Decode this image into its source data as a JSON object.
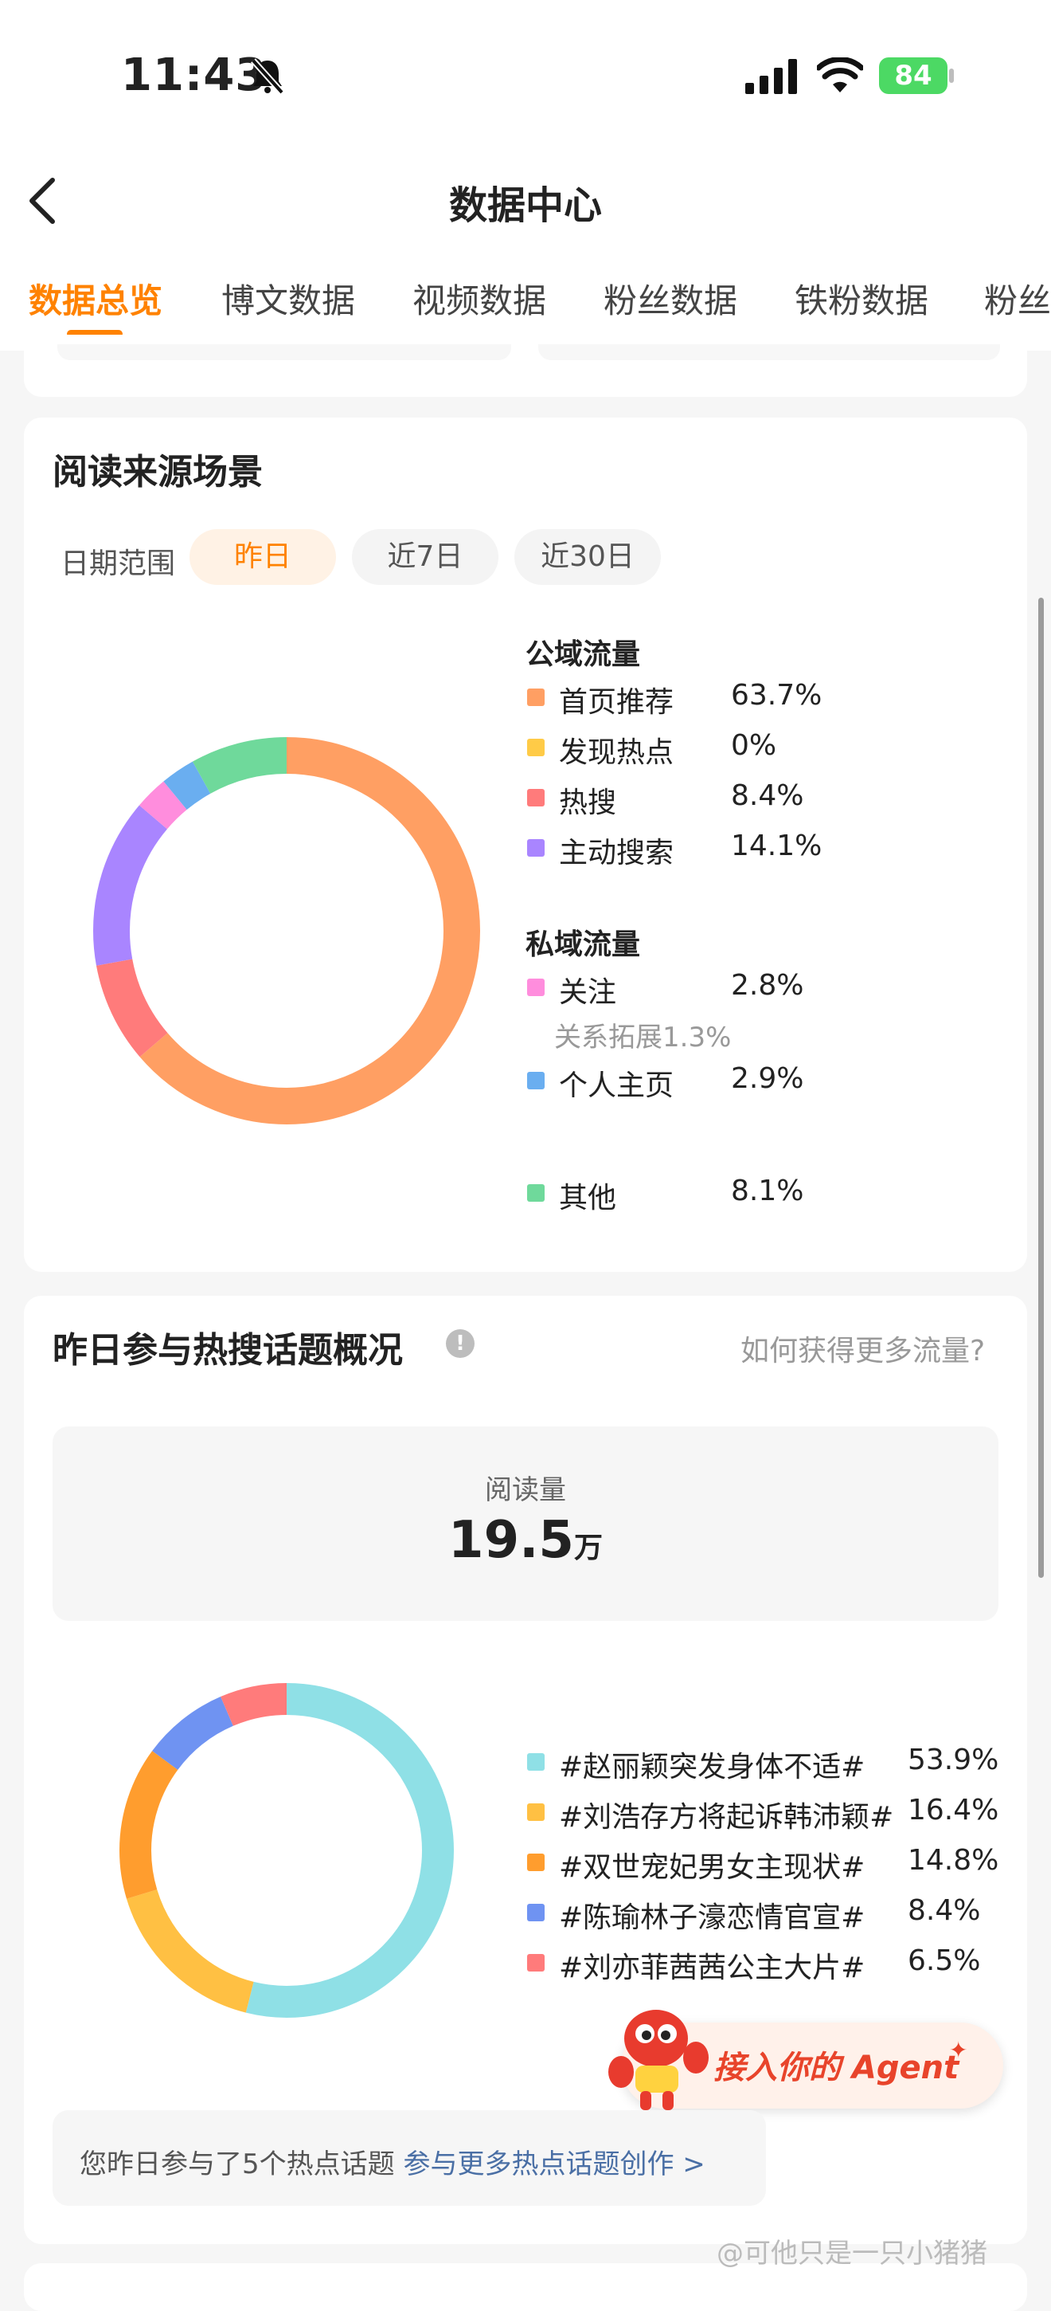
{
  "status": {
    "time": "11:43",
    "battery": "84"
  },
  "header": {
    "title": "数据中心"
  },
  "tabs": [
    {
      "label": "数据总览",
      "active": true
    },
    {
      "label": "博文数据"
    },
    {
      "label": "视频数据"
    },
    {
      "label": "粉丝数据"
    },
    {
      "label": "铁粉数据"
    },
    {
      "label": "粉丝"
    }
  ],
  "read_source": {
    "title": "阅读来源场景",
    "date_label": "日期范围",
    "ranges": [
      "昨日",
      "近7日",
      "近30日"
    ],
    "public_header": "公域流量",
    "private_header": "私域流量",
    "colors": {
      "首页推荐": "#ff9f63",
      "发现热点": "#ffcb47",
      "热搜": "#ff7b7b",
      "主动搜索": "#a985ff",
      "关注": "#ff8ddd",
      "个人主页": "#6aaef0",
      "其他": "#6fd99b"
    },
    "items": [
      {
        "label": "首页推荐",
        "value": "63.7%"
      },
      {
        "label": "发现热点",
        "value": "0%"
      },
      {
        "label": "热搜",
        "value": "8.4%"
      },
      {
        "label": "主动搜索",
        "value": "14.1%"
      },
      {
        "label": "关注",
        "value": "2.8%"
      },
      {
        "label": "个人主页",
        "value": "2.9%"
      },
      {
        "label": "其他",
        "value": "8.1%"
      }
    ],
    "relation_note": "关系拓展1.3%"
  },
  "hot_topics": {
    "title": "昨日参与热搜话题概况",
    "help_link": "如何获得更多流量?",
    "reads_label": "阅读量",
    "reads_value": "19.5",
    "reads_unit": "万",
    "items": [
      {
        "label": "#赵丽颖突发身体不适#",
        "value": "53.9%",
        "color": "#8fe0e6"
      },
      {
        "label": "#刘浩存方将起诉韩沛颖#",
        "value": "16.4%",
        "color": "#ffc043"
      },
      {
        "label": "#双世宠妃男女主现状#",
        "value": "14.8%",
        "color": "#ff9d2e"
      },
      {
        "label": "#陈瑜林子濠恋情官宣#",
        "value": "8.4%",
        "color": "#6f93f2"
      },
      {
        "label": "#刘亦菲茜茜公主大片#",
        "value": "6.5%",
        "color": "#ff7b7b"
      }
    ],
    "footer_text": "您昨日参与了5个热点话题",
    "footer_link": "参与更多热点话题创作 >",
    "agent_label": "接入你的 Agent"
  },
  "chart_data": [
    {
      "type": "pie",
      "categories": [
        "首页推荐",
        "发现热点",
        "热搜",
        "主动搜索",
        "关注",
        "个人主页",
        "其他"
      ],
      "values": [
        63.7,
        0,
        8.4,
        14.1,
        2.8,
        2.9,
        8.1
      ]
    },
    {
      "type": "pie",
      "categories": [
        "#赵丽颖突发身体不适#",
        "#刘浩存方将起诉韩沛颖#",
        "#双世宠妃男女主现状#",
        "#陈瑜林子濠恋情官宣#",
        "#刘亦菲茜茜公主大片#"
      ],
      "values": [
        53.9,
        16.4,
        14.8,
        8.4,
        6.5
      ]
    }
  ],
  "watermark": "@可他只是一只小猪猪"
}
